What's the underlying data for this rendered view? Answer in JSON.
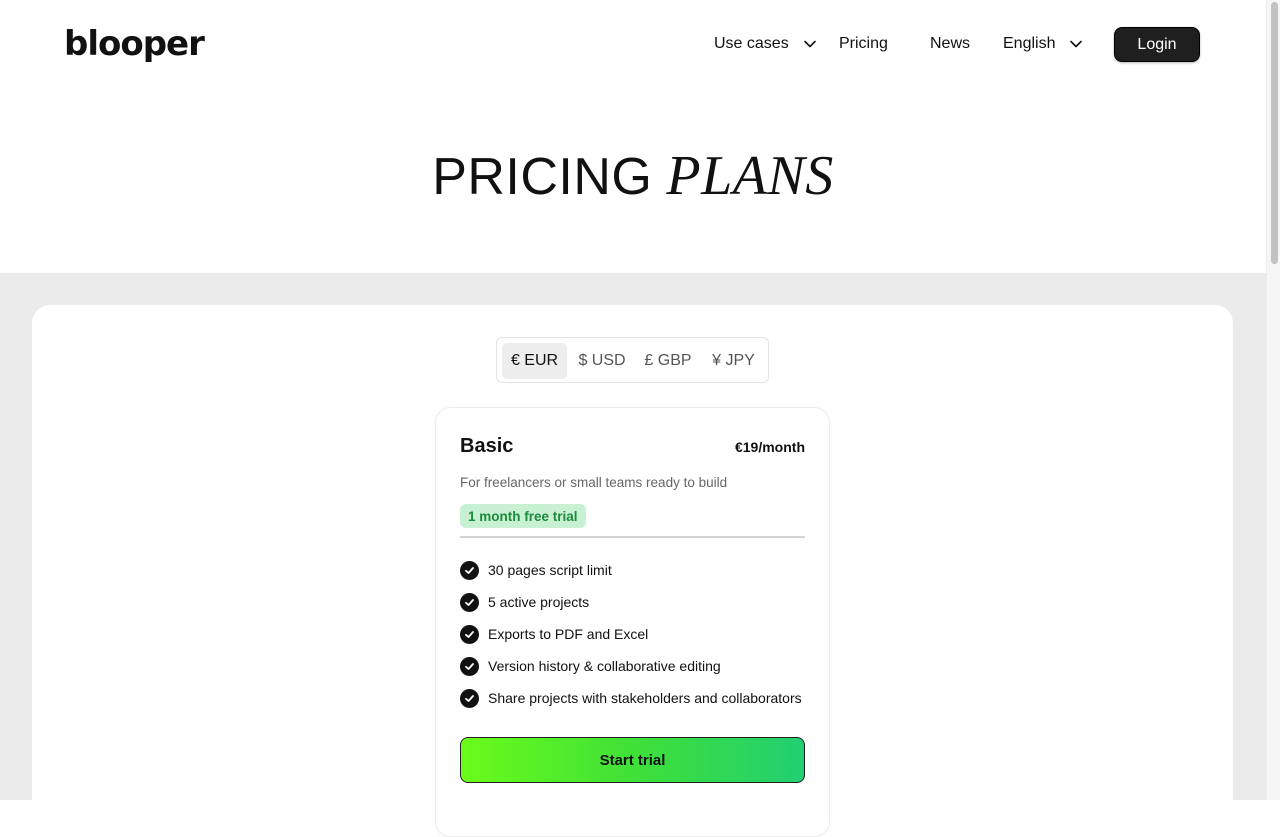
{
  "header": {
    "logo": "blooper",
    "nav": {
      "use_cases": "Use cases",
      "pricing": "Pricing",
      "news": "News",
      "language": "English"
    },
    "login_label": "Login"
  },
  "hero": {
    "title_plain": "PRICING",
    "title_italic": "PLANS"
  },
  "currency": {
    "selected": "EUR",
    "options": [
      {
        "label": "€ EUR"
      },
      {
        "label": "$ USD"
      },
      {
        "label": "£ GBP"
      },
      {
        "label": "¥ JPY"
      }
    ]
  },
  "plan": {
    "name": "Basic",
    "price": "€19/month",
    "description": "For freelancers or small teams ready to build",
    "trial_badge": "1 month free trial",
    "features": [
      "30 pages script limit",
      "5 active projects",
      "Exports to PDF and Excel",
      "Version history & collaborative editing",
      "Share projects with stakeholders and collaborators"
    ],
    "cta_label": "Start trial"
  },
  "colors": {
    "dark": "#1f1f1f",
    "section_bg": "#ebebec",
    "badge_bg": "#c8f1d4",
    "badge_text": "#1d8a3c",
    "cta_gradient_start": "#6afc1a",
    "cta_gradient_end": "#22cf72"
  }
}
